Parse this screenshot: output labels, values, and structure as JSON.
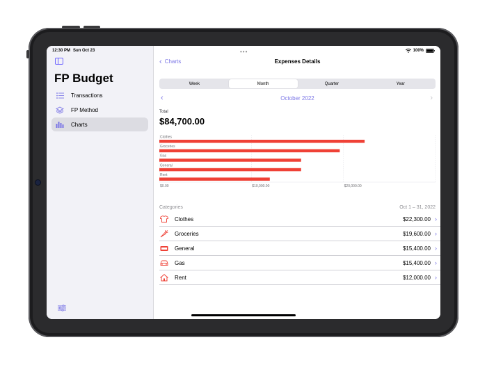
{
  "status": {
    "time": "12:30 PM",
    "date": "Sun Oct 23",
    "battery": "100%"
  },
  "sidebar": {
    "title": "FP Budget",
    "items": [
      {
        "label": "Transactions",
        "icon": "list-icon"
      },
      {
        "label": "FP Method",
        "icon": "layers-icon"
      },
      {
        "label": "Charts",
        "icon": "bar-chart-icon",
        "active": true
      }
    ]
  },
  "nav": {
    "back_label": "Charts",
    "title": "Expenses Details"
  },
  "segments": {
    "options": [
      "Week",
      "Month",
      "Quarter",
      "Year"
    ],
    "selected": "Month"
  },
  "period": {
    "label": "October 2022"
  },
  "total": {
    "caption": "Total",
    "value": "$84,700.00"
  },
  "chart_data": {
    "type": "bar",
    "orientation": "horizontal",
    "categories": [
      "Clothes",
      "Groceries",
      "Gas",
      "General",
      "Rent"
    ],
    "values": [
      22300,
      19600,
      15400,
      15400,
      12000
    ],
    "xlim": [
      0,
      30000
    ],
    "x_ticks": [
      "$0.00",
      "$10,000.00",
      "$20,000.00"
    ],
    "x_tick_values": [
      0,
      10000,
      20000
    ],
    "bar_color": "#ef4136",
    "grid": true
  },
  "categories": {
    "header": "Categories",
    "date_range": "Oct 1 – 31, 2022",
    "rows": [
      {
        "name": "Clothes",
        "amount": "$22,300.00",
        "icon": "shirt-icon"
      },
      {
        "name": "Groceries",
        "amount": "$19,600.00",
        "icon": "carrot-icon"
      },
      {
        "name": "General",
        "amount": "$15,400.00",
        "icon": "ticket-icon"
      },
      {
        "name": "Gas",
        "amount": "$15,400.00",
        "icon": "car-icon"
      },
      {
        "name": "Rent",
        "amount": "$12,000.00",
        "icon": "house-icon"
      }
    ]
  },
  "colors": {
    "accent": "#7b76e6",
    "expense": "#ef4136"
  }
}
